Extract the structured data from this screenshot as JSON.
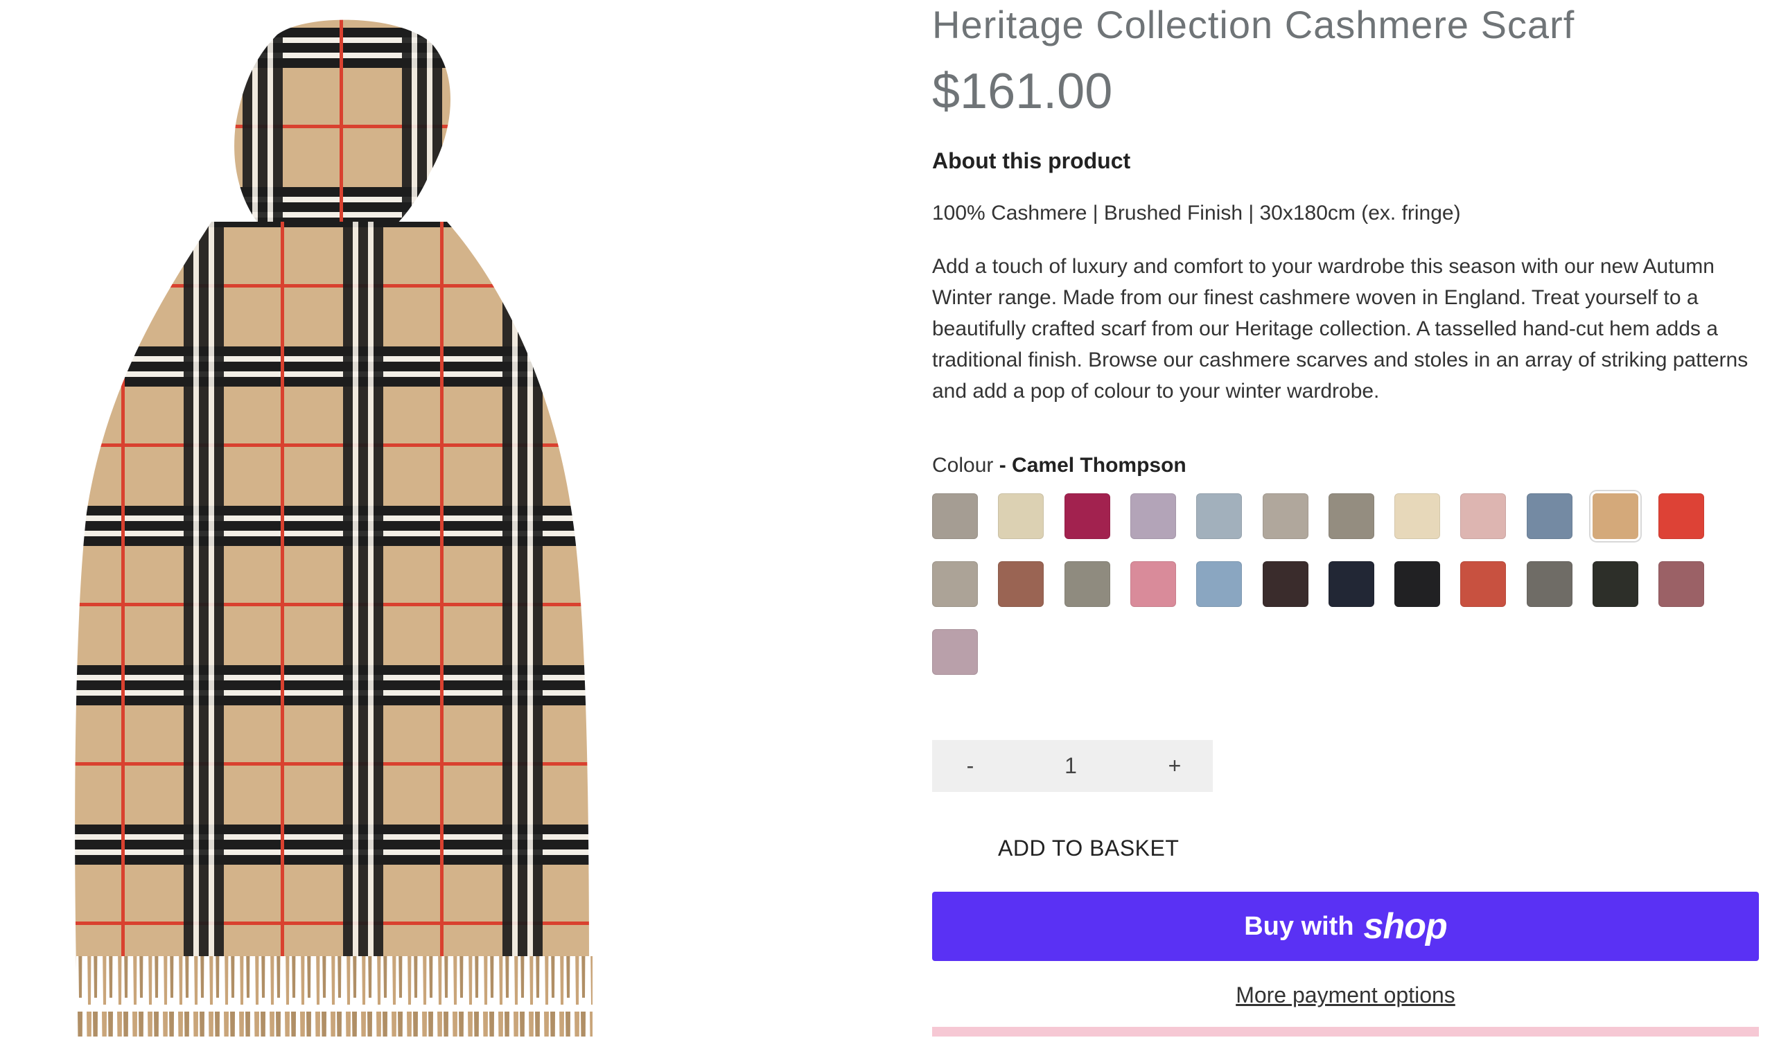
{
  "product": {
    "title": "Heritage Collection Cashmere Scarf",
    "price": "$161.00",
    "about_heading": "About this product",
    "spec": "100% Cashmere | Brushed Finish | 30x180cm (ex. fringe)",
    "description": "Add a touch of luxury and comfort to your wardrobe this season with our new Autumn Winter range. Made from our finest cashmere woven in England. Treat yourself to a beautifully crafted scarf from our Heritage collection. A tasselled hand-cut hem adds a traditional finish. Browse our cashmere scarves and stoles in an array of striking patterns and add a pop of colour to your winter wardrobe."
  },
  "colour": {
    "label": "Colour",
    "separator": " - ",
    "selected": "Camel Thompson",
    "swatches": [
      "#a59d93",
      "#dcd1b3",
      "#a2224f",
      "#b3a4b8",
      "#a2b0bc",
      "#b0a79c",
      "#948d80",
      "#e7d8ba",
      "#ddb5b1",
      "#748aa3",
      "#d4a97a",
      "#dd4236",
      "#aca397",
      "#9a6453",
      "#8f8b7f",
      "#d98b9a",
      "#8aa6c1",
      "#3a2c2c",
      "#222735",
      "#212123",
      "#c85140",
      "#6f6c66",
      "#2d2f29",
      "#9b6166",
      "#b9a0aa"
    ],
    "selected_index": 10
  },
  "quantity": {
    "minus": "-",
    "value": "1",
    "plus": "+"
  },
  "actions": {
    "add_to_basket": "ADD TO BASKET",
    "buy_with": "Buy with",
    "shop_brand": "shop",
    "more_payment": "More payment options"
  },
  "colors": {
    "shop_purple": "#5a31f4",
    "klarna_pink": "#f6c8d4",
    "title_grey": "#6f7477"
  }
}
